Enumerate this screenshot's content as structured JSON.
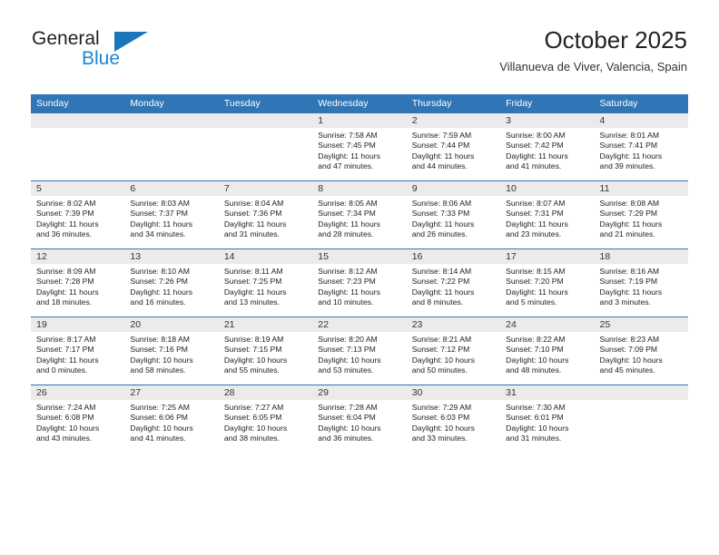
{
  "brand": {
    "name_part1": "General",
    "name_part2": "Blue",
    "logo_icon": "blue-triangle-logo",
    "color_dark": "#231f20",
    "color_blue": "#1b87d4"
  },
  "header": {
    "title": "October 2025",
    "subtitle": "Villanueva de Viver, Valencia, Spain"
  },
  "theme": {
    "header_row_bg": "#3075b5",
    "daynum_bg": "#ebebeb",
    "grid_line": "#3075b5",
    "text": "#222222"
  },
  "weekdays": [
    "Sunday",
    "Monday",
    "Tuesday",
    "Wednesday",
    "Thursday",
    "Friday",
    "Saturday"
  ],
  "weeks": [
    [
      {
        "day": "",
        "sunrise": "",
        "sunset": "",
        "daylight_line1": "",
        "daylight_line2": "",
        "blank": true
      },
      {
        "day": "",
        "sunrise": "",
        "sunset": "",
        "daylight_line1": "",
        "daylight_line2": "",
        "blank": true
      },
      {
        "day": "",
        "sunrise": "",
        "sunset": "",
        "daylight_line1": "",
        "daylight_line2": "",
        "blank": true
      },
      {
        "day": "1",
        "sunrise": "Sunrise: 7:58 AM",
        "sunset": "Sunset: 7:45 PM",
        "daylight_line1": "Daylight: 11 hours",
        "daylight_line2": "and 47 minutes."
      },
      {
        "day": "2",
        "sunrise": "Sunrise: 7:59 AM",
        "sunset": "Sunset: 7:44 PM",
        "daylight_line1": "Daylight: 11 hours",
        "daylight_line2": "and 44 minutes."
      },
      {
        "day": "3",
        "sunrise": "Sunrise: 8:00 AM",
        "sunset": "Sunset: 7:42 PM",
        "daylight_line1": "Daylight: 11 hours",
        "daylight_line2": "and 41 minutes."
      },
      {
        "day": "4",
        "sunrise": "Sunrise: 8:01 AM",
        "sunset": "Sunset: 7:41 PM",
        "daylight_line1": "Daylight: 11 hours",
        "daylight_line2": "and 39 minutes."
      }
    ],
    [
      {
        "day": "5",
        "sunrise": "Sunrise: 8:02 AM",
        "sunset": "Sunset: 7:39 PM",
        "daylight_line1": "Daylight: 11 hours",
        "daylight_line2": "and 36 minutes."
      },
      {
        "day": "6",
        "sunrise": "Sunrise: 8:03 AM",
        "sunset": "Sunset: 7:37 PM",
        "daylight_line1": "Daylight: 11 hours",
        "daylight_line2": "and 34 minutes."
      },
      {
        "day": "7",
        "sunrise": "Sunrise: 8:04 AM",
        "sunset": "Sunset: 7:36 PM",
        "daylight_line1": "Daylight: 11 hours",
        "daylight_line2": "and 31 minutes."
      },
      {
        "day": "8",
        "sunrise": "Sunrise: 8:05 AM",
        "sunset": "Sunset: 7:34 PM",
        "daylight_line1": "Daylight: 11 hours",
        "daylight_line2": "and 28 minutes."
      },
      {
        "day": "9",
        "sunrise": "Sunrise: 8:06 AM",
        "sunset": "Sunset: 7:33 PM",
        "daylight_line1": "Daylight: 11 hours",
        "daylight_line2": "and 26 minutes."
      },
      {
        "day": "10",
        "sunrise": "Sunrise: 8:07 AM",
        "sunset": "Sunset: 7:31 PM",
        "daylight_line1": "Daylight: 11 hours",
        "daylight_line2": "and 23 minutes."
      },
      {
        "day": "11",
        "sunrise": "Sunrise: 8:08 AM",
        "sunset": "Sunset: 7:29 PM",
        "daylight_line1": "Daylight: 11 hours",
        "daylight_line2": "and 21 minutes."
      }
    ],
    [
      {
        "day": "12",
        "sunrise": "Sunrise: 8:09 AM",
        "sunset": "Sunset: 7:28 PM",
        "daylight_line1": "Daylight: 11 hours",
        "daylight_line2": "and 18 minutes."
      },
      {
        "day": "13",
        "sunrise": "Sunrise: 8:10 AM",
        "sunset": "Sunset: 7:26 PM",
        "daylight_line1": "Daylight: 11 hours",
        "daylight_line2": "and 16 minutes."
      },
      {
        "day": "14",
        "sunrise": "Sunrise: 8:11 AM",
        "sunset": "Sunset: 7:25 PM",
        "daylight_line1": "Daylight: 11 hours",
        "daylight_line2": "and 13 minutes."
      },
      {
        "day": "15",
        "sunrise": "Sunrise: 8:12 AM",
        "sunset": "Sunset: 7:23 PM",
        "daylight_line1": "Daylight: 11 hours",
        "daylight_line2": "and 10 minutes."
      },
      {
        "day": "16",
        "sunrise": "Sunrise: 8:14 AM",
        "sunset": "Sunset: 7:22 PM",
        "daylight_line1": "Daylight: 11 hours",
        "daylight_line2": "and 8 minutes."
      },
      {
        "day": "17",
        "sunrise": "Sunrise: 8:15 AM",
        "sunset": "Sunset: 7:20 PM",
        "daylight_line1": "Daylight: 11 hours",
        "daylight_line2": "and 5 minutes."
      },
      {
        "day": "18",
        "sunrise": "Sunrise: 8:16 AM",
        "sunset": "Sunset: 7:19 PM",
        "daylight_line1": "Daylight: 11 hours",
        "daylight_line2": "and 3 minutes."
      }
    ],
    [
      {
        "day": "19",
        "sunrise": "Sunrise: 8:17 AM",
        "sunset": "Sunset: 7:17 PM",
        "daylight_line1": "Daylight: 11 hours",
        "daylight_line2": "and 0 minutes."
      },
      {
        "day": "20",
        "sunrise": "Sunrise: 8:18 AM",
        "sunset": "Sunset: 7:16 PM",
        "daylight_line1": "Daylight: 10 hours",
        "daylight_line2": "and 58 minutes."
      },
      {
        "day": "21",
        "sunrise": "Sunrise: 8:19 AM",
        "sunset": "Sunset: 7:15 PM",
        "daylight_line1": "Daylight: 10 hours",
        "daylight_line2": "and 55 minutes."
      },
      {
        "day": "22",
        "sunrise": "Sunrise: 8:20 AM",
        "sunset": "Sunset: 7:13 PM",
        "daylight_line1": "Daylight: 10 hours",
        "daylight_line2": "and 53 minutes."
      },
      {
        "day": "23",
        "sunrise": "Sunrise: 8:21 AM",
        "sunset": "Sunset: 7:12 PM",
        "daylight_line1": "Daylight: 10 hours",
        "daylight_line2": "and 50 minutes."
      },
      {
        "day": "24",
        "sunrise": "Sunrise: 8:22 AM",
        "sunset": "Sunset: 7:10 PM",
        "daylight_line1": "Daylight: 10 hours",
        "daylight_line2": "and 48 minutes."
      },
      {
        "day": "25",
        "sunrise": "Sunrise: 8:23 AM",
        "sunset": "Sunset: 7:09 PM",
        "daylight_line1": "Daylight: 10 hours",
        "daylight_line2": "and 45 minutes."
      }
    ],
    [
      {
        "day": "26",
        "sunrise": "Sunrise: 7:24 AM",
        "sunset": "Sunset: 6:08 PM",
        "daylight_line1": "Daylight: 10 hours",
        "daylight_line2": "and 43 minutes."
      },
      {
        "day": "27",
        "sunrise": "Sunrise: 7:25 AM",
        "sunset": "Sunset: 6:06 PM",
        "daylight_line1": "Daylight: 10 hours",
        "daylight_line2": "and 41 minutes."
      },
      {
        "day": "28",
        "sunrise": "Sunrise: 7:27 AM",
        "sunset": "Sunset: 6:05 PM",
        "daylight_line1": "Daylight: 10 hours",
        "daylight_line2": "and 38 minutes."
      },
      {
        "day": "29",
        "sunrise": "Sunrise: 7:28 AM",
        "sunset": "Sunset: 6:04 PM",
        "daylight_line1": "Daylight: 10 hours",
        "daylight_line2": "and 36 minutes."
      },
      {
        "day": "30",
        "sunrise": "Sunrise: 7:29 AM",
        "sunset": "Sunset: 6:03 PM",
        "daylight_line1": "Daylight: 10 hours",
        "daylight_line2": "and 33 minutes."
      },
      {
        "day": "31",
        "sunrise": "Sunrise: 7:30 AM",
        "sunset": "Sunset: 6:01 PM",
        "daylight_line1": "Daylight: 10 hours",
        "daylight_line2": "and 31 minutes."
      },
      {
        "day": "",
        "sunrise": "",
        "sunset": "",
        "daylight_line1": "",
        "daylight_line2": "",
        "blank": true
      }
    ]
  ]
}
